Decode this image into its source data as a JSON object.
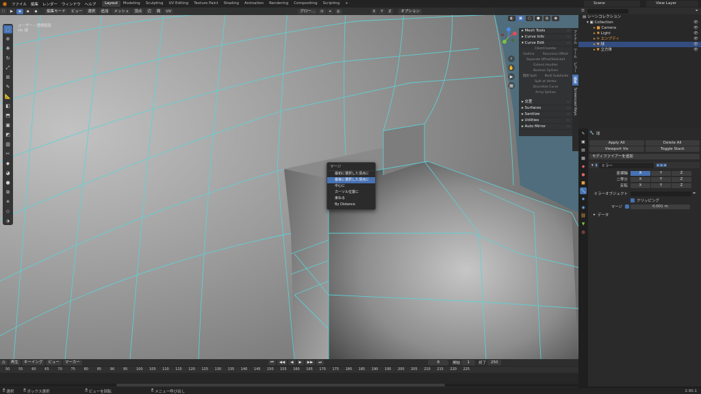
{
  "topbar": {
    "menus": [
      "ファイル",
      "編集",
      "レンダー",
      "ウィンドウ",
      "ヘルプ"
    ],
    "workspaces": [
      "Layout",
      "Modeling",
      "Sculpting",
      "UV Editing",
      "Texture Paint",
      "Shading",
      "Animation",
      "Rendering",
      "Compositing",
      "Scripting"
    ],
    "active_workspace": "Layout",
    "add_tab": "+",
    "scene": "Scene",
    "view_layer": "View Layer"
  },
  "viewport": {
    "mode": "編集モード",
    "header_menus": [
      "ビュー",
      "選択",
      "追加",
      "メッシュ",
      "頂点",
      "辺",
      "面",
      "UV"
    ],
    "orientation": "グロー...",
    "options_label": "オプション",
    "axes": [
      "X",
      "Y",
      "Z"
    ],
    "label_line1": "ユーザー・透視投影",
    "label_line2": "(4) 球"
  },
  "npanel": {
    "sections_top": [
      "Mesh Tools",
      "Curve Info",
      "Curve Edit"
    ],
    "curve_edit_buttons": [
      "Fillet/Chamfer",
      "Outline",
      "Recursive Offset",
      "Separate Offset/Selected",
      "Extend Handles",
      "Boolean Splines",
      "開閉 Split",
      "Multi Subdivide",
      "Split at Vertex",
      "Discretize Curve",
      "Array Splines"
    ],
    "sections_bottom": [
      "交差",
      "Surfaces",
      "Sanitize",
      "Utilities",
      "Auto Mirror"
    ],
    "tabs": [
      "アイテム",
      "ツール",
      "ビュー",
      "編集",
      "Screencast Keys"
    ],
    "active_tab": "編集"
  },
  "context_menu": {
    "title": "マージ",
    "items": [
      "最初に選択した頂点に",
      "最後に選択した頂点に",
      "中心に",
      "カーソル位置に",
      "束ねる",
      "By Distance"
    ],
    "active_index": 1
  },
  "outliner": {
    "title": "シーンコレクション",
    "collection": "Collection",
    "objects": [
      {
        "name": "Camera",
        "selected": false
      },
      {
        "name": "Light",
        "selected": false
      },
      {
        "name": "エンプティ",
        "selected": false
      },
      {
        "name": "球",
        "selected": true
      },
      {
        "name": "立方体",
        "selected": false
      }
    ]
  },
  "properties": {
    "object_name": "球",
    "apply_all": "Apply All",
    "delete_all": "Delete All",
    "viewport_vis": "Viewport Vis",
    "toggle_stack": "Toggle Stack",
    "add_modifier": "モディファイアーを追加",
    "modifier_name": "ミラー",
    "axis_label": "座標軸",
    "bisect_label": "二等分",
    "flip_label": "反転",
    "axes": [
      "X",
      "Y",
      "Z"
    ],
    "mirror_object_label": "ミラーオブジェクト",
    "clipping_label": "クリッピング",
    "merge_label": "マージ",
    "merge_value": "0.001 m",
    "data_label": "データ"
  },
  "timeline": {
    "menus": [
      "再生",
      "キーイング",
      "ビュー",
      "マーカー"
    ],
    "current_frame": "8",
    "start_label": "開始",
    "start": "1",
    "end_label": "終了",
    "end": "250",
    "ticks": [
      "50",
      "55",
      "60",
      "65",
      "70",
      "75",
      "80",
      "85",
      "90",
      "95",
      "100",
      "105",
      "110",
      "115",
      "120",
      "125",
      "130",
      "135",
      "140",
      "145",
      "150",
      "155",
      "160",
      "165",
      "170",
      "175",
      "180",
      "185",
      "190",
      "195",
      "200",
      "205",
      "210",
      "215",
      "220",
      "225"
    ]
  },
  "statusbar": {
    "select": "選択",
    "box_select": "ボックス選択",
    "rotate_view": "ビューを回転",
    "call_menu": "メニュー呼び出し",
    "version": "2.90.1"
  },
  "colors": {
    "accent": "#4772b3",
    "wire": "#5cd3d8",
    "orange": "#e87d0d"
  }
}
